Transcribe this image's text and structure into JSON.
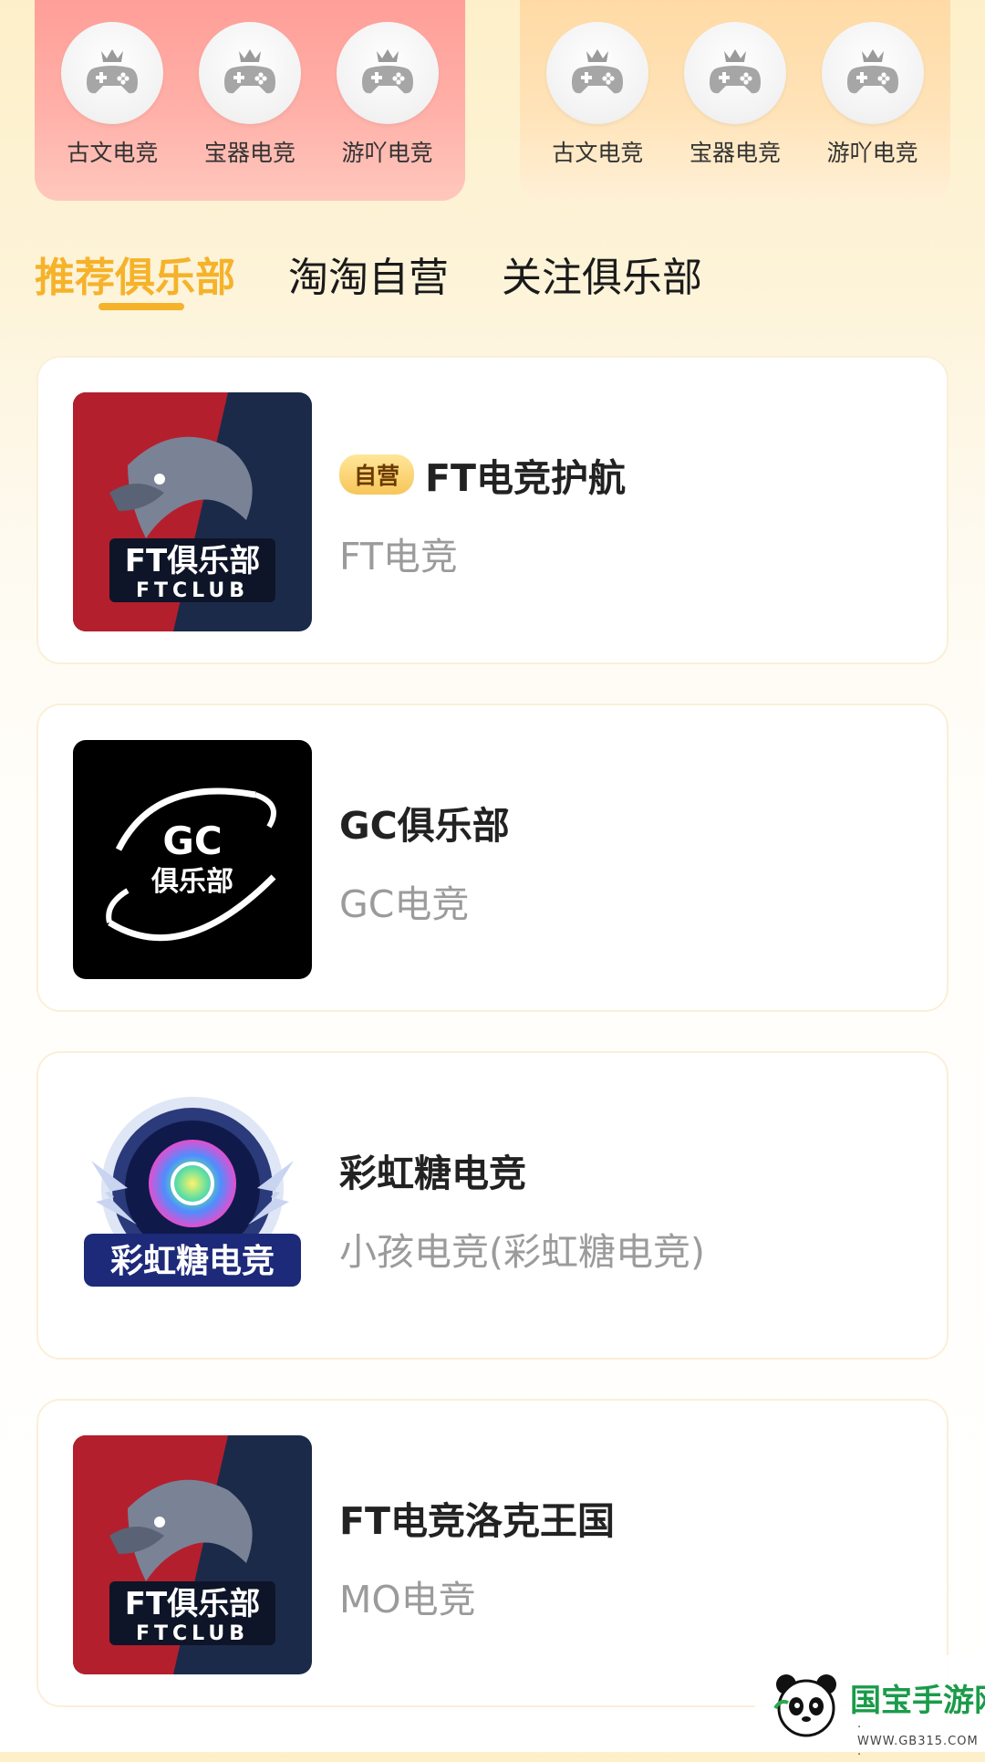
{
  "categories_left": [
    {
      "label": "古文电竞",
      "icon": "gamepad-crown-icon"
    },
    {
      "label": "宝器电竞",
      "icon": "gamepad-crown-icon"
    },
    {
      "label": "游吖电竞",
      "icon": "gamepad-crown-icon"
    }
  ],
  "categories_right": [
    {
      "label": "古文电竞",
      "icon": "gamepad-crown-icon"
    },
    {
      "label": "宝器电竞",
      "icon": "gamepad-crown-icon"
    },
    {
      "label": "游吖电竞",
      "icon": "gamepad-crown-icon"
    }
  ],
  "tabs": [
    {
      "label": "推荐俱乐部",
      "active": true
    },
    {
      "label": "淘淘自营",
      "active": false
    },
    {
      "label": "关注俱乐部",
      "active": false
    }
  ],
  "clubs": [
    {
      "badge": "自营",
      "title": "FT电竞护航",
      "subtitle": "FT电竞",
      "logo": "ft-club-logo",
      "logo_text": "FT俱乐部",
      "logo_sub": "FTCLUB"
    },
    {
      "badge": "",
      "title": "GC俱乐部",
      "subtitle": "GC电竞",
      "logo": "gc-club-logo",
      "logo_text": "GC",
      "logo_sub": "俱乐部"
    },
    {
      "badge": "",
      "title": "彩虹糖电竞",
      "subtitle": "小孩电竞(彩虹糖电竞)",
      "logo": "rainbow-candy-logo",
      "logo_text": "彩虹糖电竞"
    },
    {
      "badge": "",
      "title": "FT电竞洛克王国",
      "subtitle": "MO电竞",
      "logo": "ft-club-logo",
      "logo_text": "FT俱乐部",
      "logo_sub": "FTCLUB"
    }
  ],
  "watermark": {
    "text": "国宝手游网",
    "url": "· WWW.GB315.COM ·"
  },
  "colors": {
    "accent": "#f5b22a",
    "title": "#222222",
    "subtitle": "#9b9b9b",
    "left_panel": "#ff9a94",
    "right_panel": "#ffd8a0"
  }
}
